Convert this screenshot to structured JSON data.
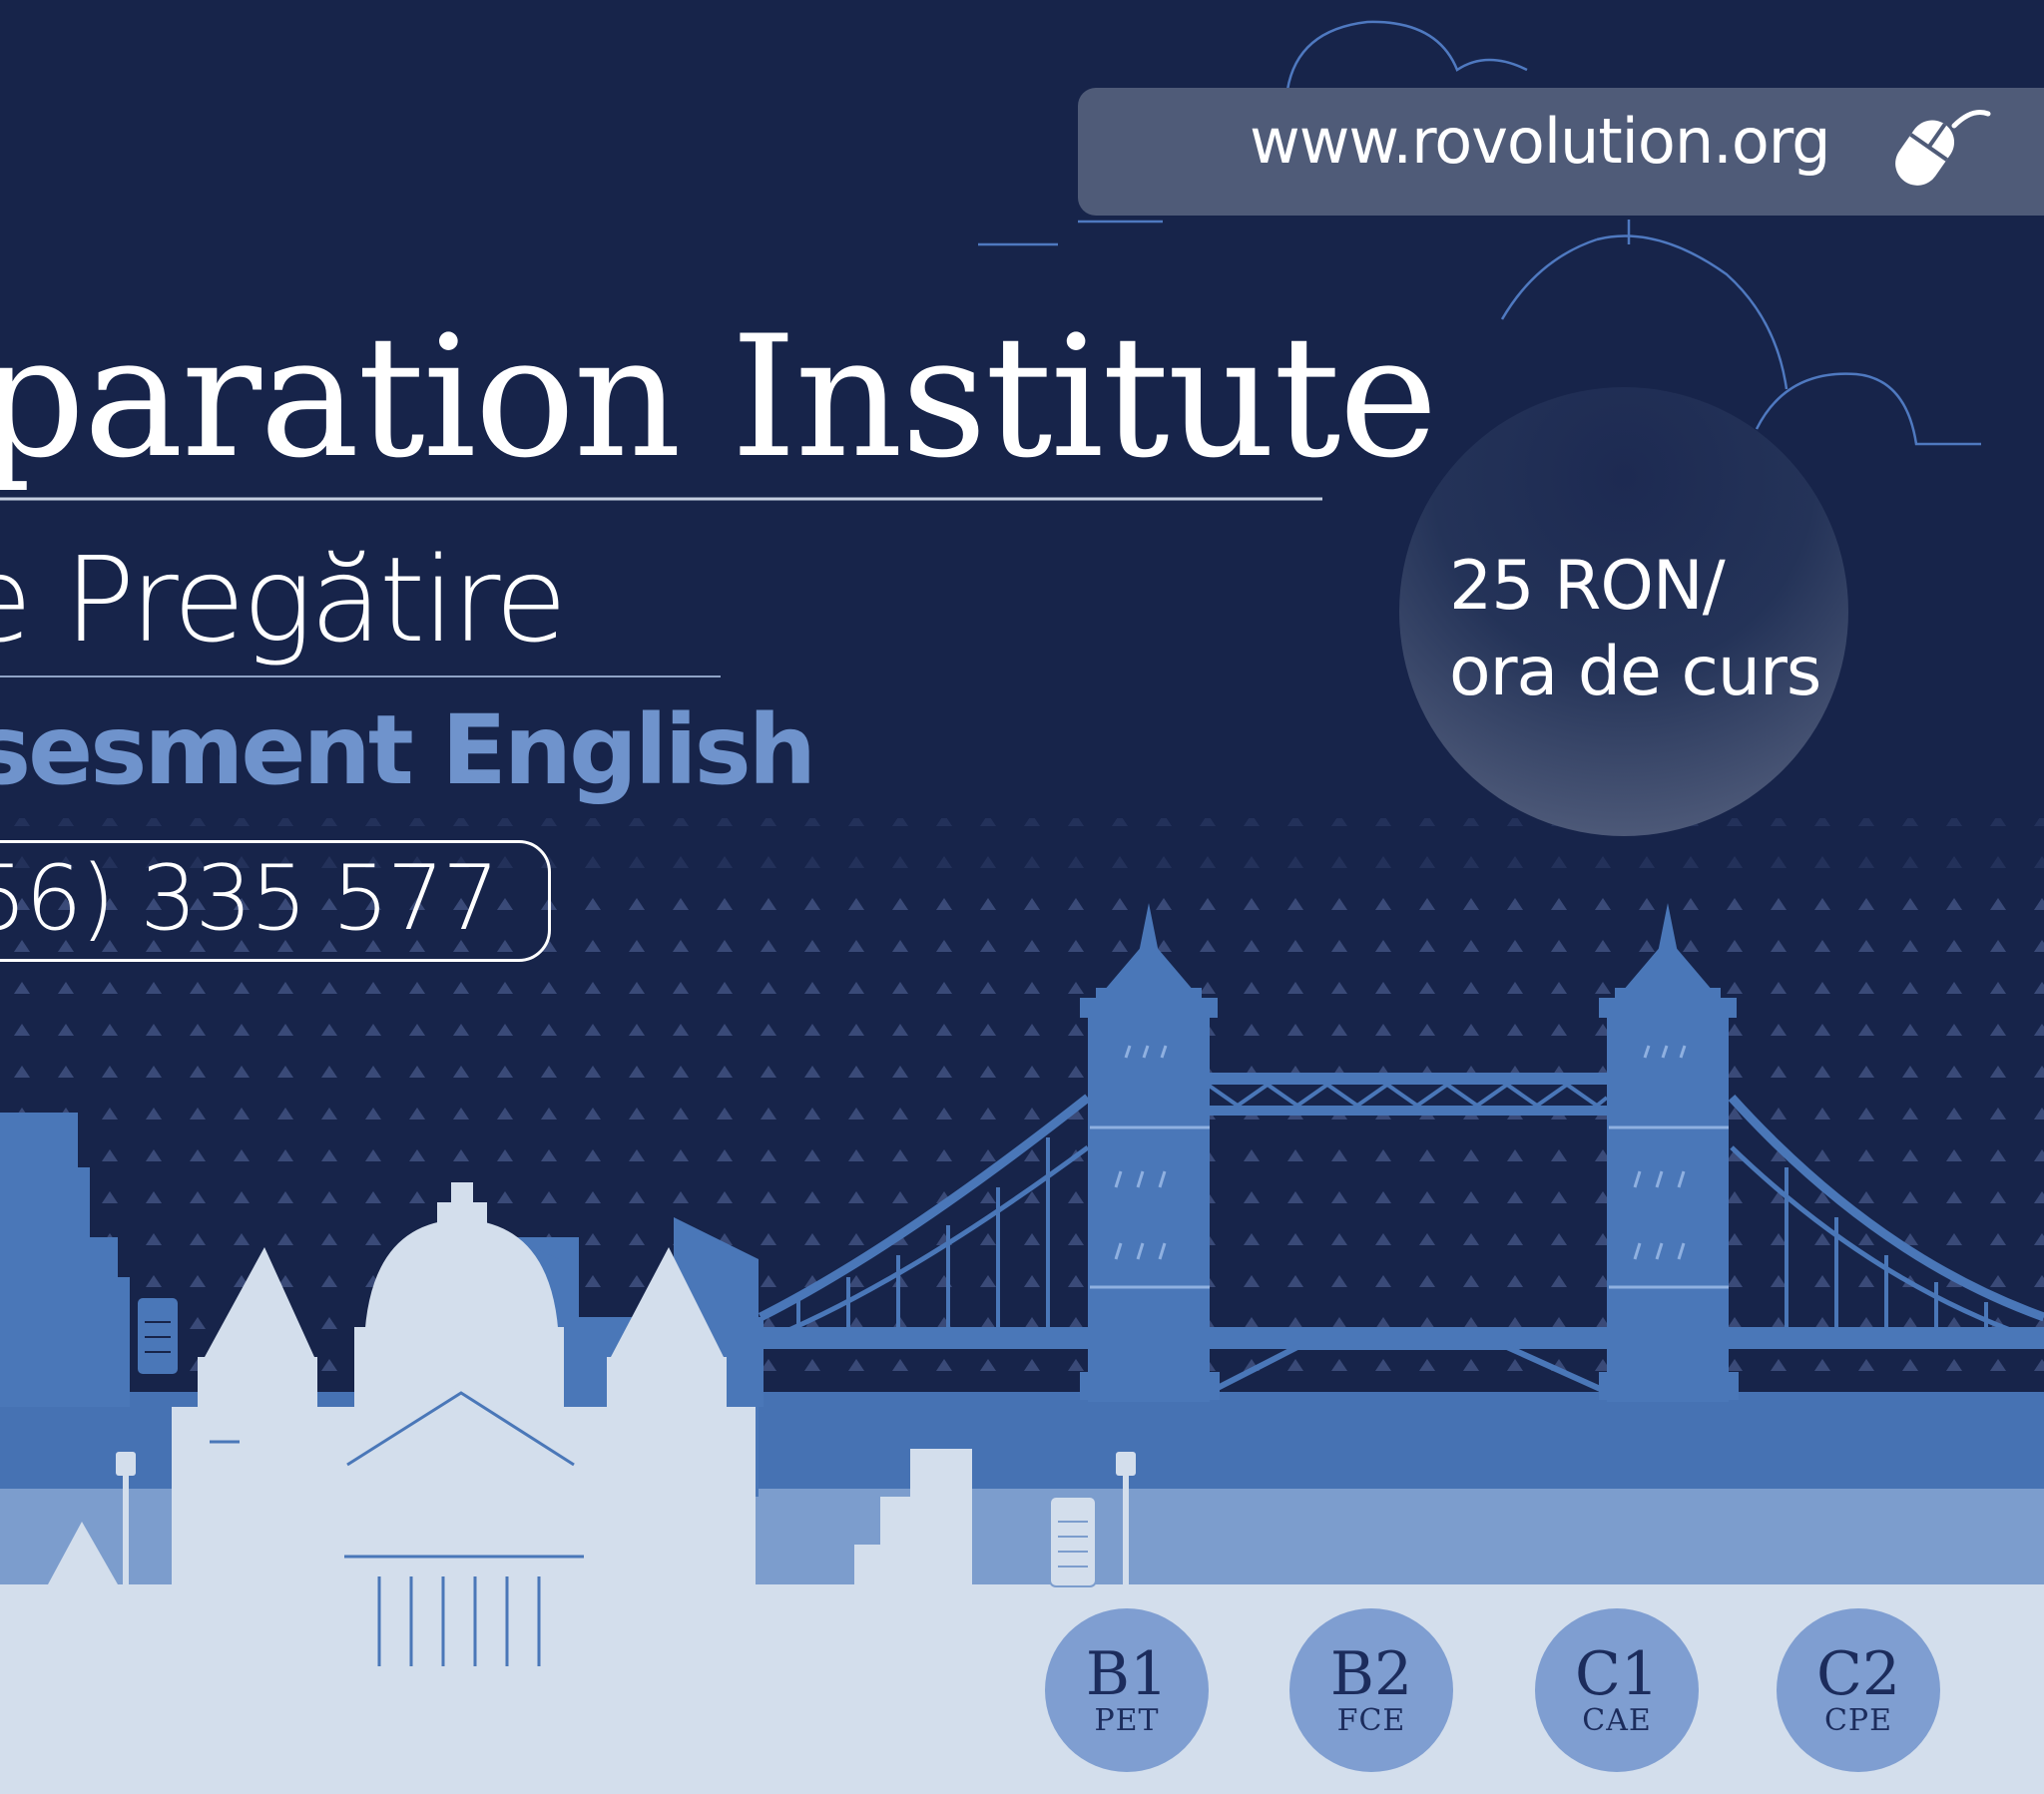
{
  "header": {
    "website": "www.rovolution.org"
  },
  "headline": {
    "title": "paration Institute",
    "subtitle": "e Pregătire",
    "tagline": "sesment English",
    "phone": "56) 335 577"
  },
  "price": {
    "line1": "25 RON/",
    "line2": "ora de curs"
  },
  "levels": [
    {
      "code": "B1",
      "exam": "PET"
    },
    {
      "code": "B2",
      "exam": "FCE"
    },
    {
      "code": "C1",
      "exam": "CAE"
    },
    {
      "code": "C2",
      "exam": "CPE"
    }
  ],
  "icons": {
    "mouse": "computer-mouse-icon"
  },
  "colors": {
    "background": "#17244a",
    "accent_text": "#6f93cc",
    "building_blue": "#4a77b8",
    "light_building": "#d3deec",
    "level_badge": "#7f9ed1",
    "url_box": "#4f5b78"
  }
}
